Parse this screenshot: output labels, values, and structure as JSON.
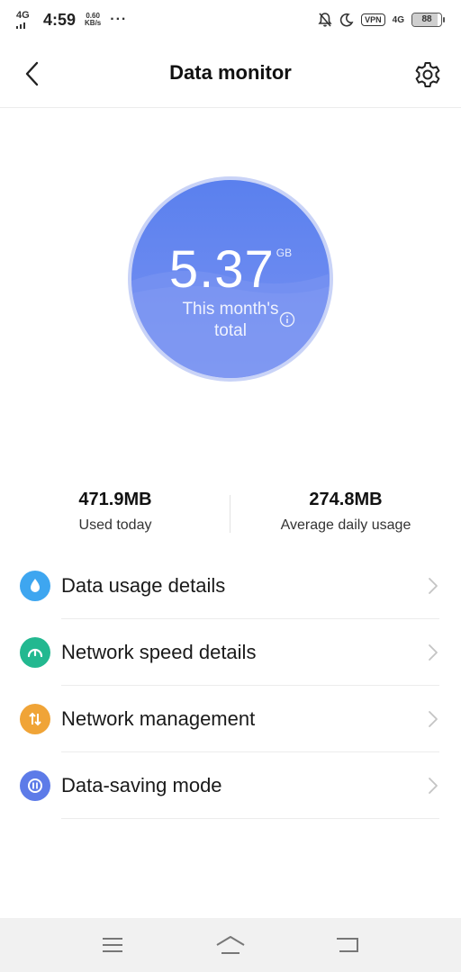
{
  "status_bar": {
    "network": "4G",
    "time": "4:59",
    "speed_value": "0.60",
    "speed_unit": "KB/s",
    "more": "···",
    "vpn": "VPN",
    "mobile_type": "4G",
    "battery_level": 88,
    "icons": [
      "signal-icon",
      "mute-bell-icon",
      "moon-icon",
      "vpn-icon",
      "battery-icon"
    ]
  },
  "header": {
    "title": "Data monitor",
    "back_icon": "chevron-left-icon",
    "settings_icon": "gear-icon"
  },
  "usage_circle": {
    "value": "5.37",
    "unit": "GB",
    "label_line1": "This month's",
    "label_line2": "total",
    "info_icon": "info-icon"
  },
  "stats": [
    {
      "value": "471.9MB",
      "label": "Used today"
    },
    {
      "value": "274.8MB",
      "label": "Average daily usage"
    }
  ],
  "menu": [
    {
      "label": "Data usage details",
      "icon": "drop-icon",
      "color": "#3ea6f0"
    },
    {
      "label": "Network speed details",
      "icon": "speedometer-icon",
      "color": "#23b890"
    },
    {
      "label": "Network management",
      "icon": "arrows-updown-icon",
      "color": "#f0a437"
    },
    {
      "label": "Data-saving mode",
      "icon": "data-saving-icon",
      "color": "#5d7be8"
    }
  ],
  "nav_bar": {
    "icons": [
      "menu-icon",
      "home-icon",
      "back-icon"
    ]
  },
  "colors": {
    "circle_primary": "#5a80ee",
    "circle_ring": "#c9d3f7",
    "divider": "#ececec"
  }
}
